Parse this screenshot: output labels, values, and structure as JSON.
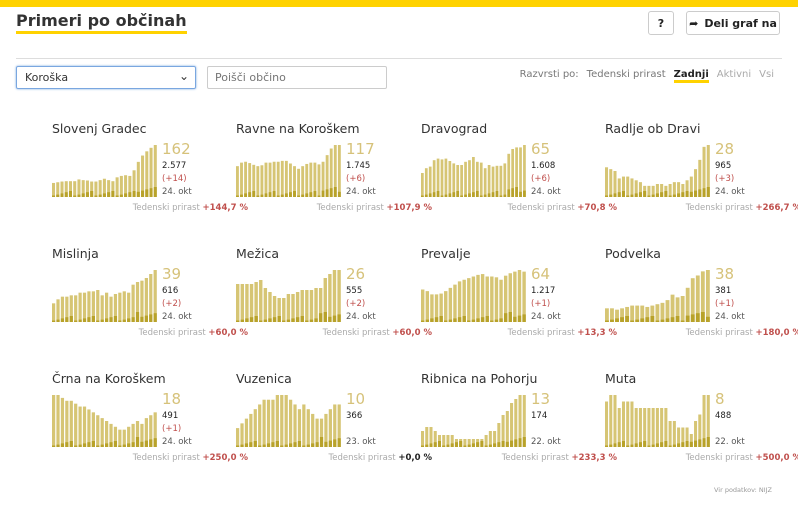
{
  "header": {
    "title": "Primeri po občinah",
    "help_label": "?",
    "share_label": "Deli graf na",
    "share_icon": "share-arrow-icon"
  },
  "filters": {
    "region": "Koroška",
    "search_placeholder": "Poišči občino",
    "sort_label": "Razvrsti po:",
    "sort_options": [
      "Tedenski prirast",
      "Zadnji",
      "Aktivni",
      "Vsi"
    ],
    "sort_active": "Zadnji"
  },
  "colors": {
    "accent": "#ffd200",
    "bar": "#d6c574",
    "bar_dark": "#b8a22a",
    "increase": "#c0504d"
  },
  "growth_label": "Tedenski prirast",
  "municipalities": [
    {
      "name": "Slovenj Gradec",
      "active": "162",
      "total": "2.577",
      "new": "(+14)",
      "date": "24. okt",
      "growth": "+144,7 %",
      "series": [
        40,
        42,
        44,
        45,
        45,
        45,
        50,
        48,
        47,
        44,
        44,
        48,
        52,
        48,
        45,
        56,
        60,
        62,
        60,
        76,
        100,
        118,
        130,
        140,
        148
      ]
    },
    {
      "name": "Ravne na Koroškem",
      "active": "117",
      "total": "1.745",
      "new": "(+6)",
      "date": "24. okt",
      "growth": "+107,9 %",
      "series": [
        70,
        78,
        80,
        77,
        73,
        70,
        72,
        78,
        78,
        80,
        80,
        82,
        82,
        76,
        70,
        64,
        70,
        75,
        78,
        78,
        74,
        80,
        95,
        110,
        118,
        118
      ]
    },
    {
      "name": "Dravograd",
      "active": "65",
      "total": "1.608",
      "new": "(+6)",
      "date": "24. okt",
      "growth": "+70,8 %",
      "series": [
        30,
        36,
        38,
        46,
        48,
        47,
        48,
        45,
        42,
        40,
        40,
        44,
        46,
        50,
        44,
        43,
        36,
        40,
        38,
        39,
        39,
        42,
        54,
        60,
        62,
        62,
        65
      ]
    },
    {
      "name": "Radlje ob Dravi",
      "active": "28",
      "total": "965",
      "new": "(+3)",
      "date": "24. okt",
      "growth": "+266,7 %",
      "series": [
        16,
        15,
        14,
        10,
        11,
        11,
        10,
        9,
        8,
        6,
        6,
        6,
        7,
        7,
        6,
        7,
        8,
        8,
        7,
        9,
        11,
        15,
        20,
        27,
        28
      ]
    },
    {
      "name": "Mislinja",
      "active": "39",
      "total": "616",
      "new": "(+2)",
      "date": "24. okt",
      "growth": "+60,0 %",
      "series": [
        14,
        17,
        19,
        19,
        20,
        20,
        22,
        22,
        23,
        23,
        24,
        20,
        22,
        19,
        21,
        22,
        23,
        22,
        28,
        30,
        31,
        33,
        36,
        39
      ]
    },
    {
      "name": "Mežica",
      "active": "26",
      "total": "555",
      "new": "(+2)",
      "date": "24. okt",
      "growth": "+60,0 %",
      "series": [
        19,
        19,
        19,
        19,
        20,
        21,
        17,
        15,
        13,
        12,
        12,
        14,
        14,
        15,
        16,
        16,
        16,
        17,
        17,
        22,
        24,
        26,
        26
      ]
    },
    {
      "name": "Prevalje",
      "active": "64",
      "total": "1.217",
      "new": "(+1)",
      "date": "24. okt",
      "growth": "+13,3 %",
      "series": [
        40,
        38,
        34,
        34,
        35,
        38,
        42,
        46,
        50,
        52,
        54,
        56,
        58,
        59,
        56,
        56,
        55,
        52,
        57,
        60,
        62,
        64,
        62
      ]
    },
    {
      "name": "Podvelka",
      "active": "38",
      "total": "381",
      "new": "(+1)",
      "date": "24. okt",
      "growth": "+180,0 %",
      "series": [
        10,
        10,
        9,
        10,
        11,
        12,
        12,
        12,
        11,
        12,
        13,
        14,
        16,
        20,
        18,
        19,
        25,
        32,
        34,
        37,
        38
      ]
    },
    {
      "name": "Črna na Koroškem",
      "active": "18",
      "total": "491",
      "new": "(+1)",
      "date": "24. okt",
      "growth": "+250,0 %",
      "series": [
        18,
        18,
        17,
        16,
        16,
        15,
        14,
        14,
        13,
        12,
        11,
        10,
        9,
        8,
        7,
        6,
        6,
        7,
        8,
        9,
        8,
        10,
        11,
        12
      ]
    },
    {
      "name": "Vuzenica",
      "active": "10",
      "total": "366",
      "new": "",
      "date": "23. okt",
      "growth": "+0,0 %",
      "series": [
        4,
        5,
        6,
        7,
        8,
        9,
        10,
        10,
        10,
        11,
        11,
        11,
        10,
        9,
        8,
        9,
        8,
        7,
        6,
        6,
        7,
        8,
        9,
        9
      ]
    },
    {
      "name": "Ribnica na Pohorju",
      "active": "13",
      "total": "174",
      "new": "",
      "date": "22. okt",
      "growth": "+233,3 %",
      "series": [
        4,
        5,
        5,
        4,
        3,
        3,
        3,
        3,
        2,
        2,
        2,
        2,
        2,
        2,
        2,
        3,
        4,
        4,
        6,
        8,
        9,
        11,
        12,
        13,
        13
      ]
    },
    {
      "name": "Muta",
      "active": "8",
      "total": "488",
      "new": "",
      "date": "22. okt",
      "growth": "+500,0 %",
      "series": [
        7,
        8,
        8,
        6,
        7,
        7,
        7,
        6,
        6,
        6,
        6,
        6,
        6,
        6,
        6,
        4,
        4,
        3,
        3,
        3,
        2,
        4,
        5,
        8,
        8
      ]
    }
  ],
  "source": "Vir podatkov: NIJZ"
}
